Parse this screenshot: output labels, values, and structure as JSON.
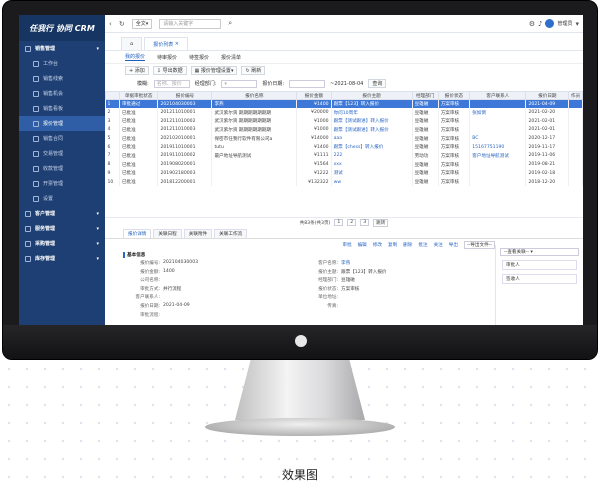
{
  "app": {
    "brand": "任我行 协同 CRM"
  },
  "sidebar": [
    {
      "label": "销售管理",
      "level": "top"
    },
    {
      "label": "工作台",
      "level": "sub"
    },
    {
      "label": "销售线索",
      "level": "sub"
    },
    {
      "label": "销售机会",
      "level": "sub"
    },
    {
      "label": "销售看板",
      "level": "sub"
    },
    {
      "label": "报价管理",
      "level": "sub",
      "active": true
    },
    {
      "label": "销售合同",
      "level": "sub"
    },
    {
      "label": "交易管理",
      "level": "sub"
    },
    {
      "label": "收款管理",
      "level": "sub"
    },
    {
      "label": "开票管理",
      "level": "sub"
    },
    {
      "label": "设置",
      "level": "sub"
    },
    {
      "label": "客户管理",
      "level": "top"
    },
    {
      "label": "服务管理",
      "level": "top"
    },
    {
      "label": "采购管理",
      "level": "top"
    },
    {
      "label": "库存管理",
      "level": "top"
    }
  ],
  "topbar": {
    "scope": "全文",
    "search_placeholder": "请输入关键字",
    "user": "管理员"
  },
  "tabs": [
    "",
    "报价列表"
  ],
  "subtabs": [
    "我的报价",
    "待审报价",
    "待签报价",
    "报价清单"
  ],
  "toolbar": [
    "添加",
    "导出数据",
    "报价管理设置",
    "刷新"
  ],
  "filters": {
    "name_label": "模糊:",
    "name_placeholder": "名称、报价",
    "dept_label": "经理部门:",
    "date_label": "报价日期:",
    "date_to": "~2021-08-04",
    "query_label": "查询"
  },
  "grid": {
    "headers": [
      "",
      "单据审批状态",
      "报价编号",
      "报价名称",
      "报价金额",
      "报价主题",
      "经理部门",
      "报价状态",
      "客户联系人",
      "报价日期",
      "作员"
    ],
    "rows": [
      [
        "1",
        "审批通过",
        "202104030003",
        "李燕",
        "¥1400",
        "跟票【123】转入报价",
        "豆雄磁",
        "方案审核",
        "",
        "2021-04-09",
        ""
      ],
      [
        "2",
        "已批准",
        "201211010001",
        "武汉紫尔资 期期期期期期期",
        "¥20000",
        "你问10周年",
        "豆雄磁",
        "方案审核",
        "张如倒",
        "2021-02-20",
        ""
      ],
      [
        "3",
        "已批准",
        "201211010002",
        "武汉紫尔资 期期期期期期期",
        "¥1000",
        "跟票【测试跟进】转入报价",
        "豆雄磁",
        "方案审核",
        "",
        "2021-02-01",
        ""
      ],
      [
        "4",
        "已批准",
        "201211010003",
        "武汉紫尔资 期期期期期期期",
        "¥1000",
        "跟票【测试跟进】转入报价",
        "豆雄磁",
        "方案审核",
        "",
        "2021-02-01",
        ""
      ],
      [
        "5",
        "已批准",
        "202102010001",
        "保密市任我行软件有限公司a",
        "¥14000",
        "aaa",
        "豆雄磁",
        "方案审核",
        "BC",
        "2020-12-17",
        ""
      ],
      [
        "6",
        "已批准",
        "201911010001",
        "tutu",
        "¥1400",
        "跟票【chess】转入报价",
        "豆雄磁",
        "方案审核",
        "15167751190",
        "2019-11-17",
        ""
      ],
      [
        "7",
        "已批准",
        "201911010002",
        "最户地址导航测试",
        "¥1111",
        "222",
        "劳动功",
        "方案审核",
        "客户地址导航测试",
        "2019-11-06",
        ""
      ],
      [
        "8",
        "已批准",
        "201908020001",
        "",
        "¥1564",
        "xxx",
        "豆雄磁",
        "方案审核",
        "",
        "2019-08-21",
        ""
      ],
      [
        "9",
        "已批准",
        "201902180003",
        "",
        "¥1222",
        "测试",
        "豆雄磁",
        "方案审核",
        "",
        "2019-02-18",
        ""
      ],
      [
        "10",
        "已批准",
        "201812200001",
        "",
        "¥132322",
        "ww",
        "豆雄磁",
        "方案审核",
        "",
        "2018-12-20",
        ""
      ]
    ]
  },
  "pager": {
    "summary": "共83条(共3页)",
    "pages": [
      "1",
      "2",
      "3"
    ],
    "goto": "跳转"
  },
  "detail_tabs": [
    "报价详情",
    "关联日程",
    "关联附件",
    "关联工作流"
  ],
  "actions": [
    "审批",
    "编辑",
    "修改",
    "复制",
    "删除",
    "批注",
    "关注",
    "导出",
    "--导出文件--"
  ],
  "detail": {
    "section": "基本信息",
    "fields": [
      [
        "报价编号:",
        "202104030003",
        "客户名称:",
        "李燕"
      ],
      [
        "报价金额:",
        "1400",
        "报价主题:",
        "跟票【123】转入报价"
      ],
      [
        "公司名称:",
        "",
        "经理部门:",
        "豆雄磁"
      ],
      [
        "审批方式:",
        "并行流程",
        "报价状态:",
        "方案审核"
      ],
      [
        "客户联系人:",
        "",
        "单位地址:",
        ""
      ],
      [
        "报价日期:",
        "2021-04-09",
        "传真:",
        ""
      ],
      [
        "审批流程:",
        "",
        "",
        ""
      ]
    ]
  },
  "side_panel": {
    "dropdown": "--查看关联--",
    "items": [
      "审批人",
      "签收人"
    ]
  },
  "caption": "效果图"
}
